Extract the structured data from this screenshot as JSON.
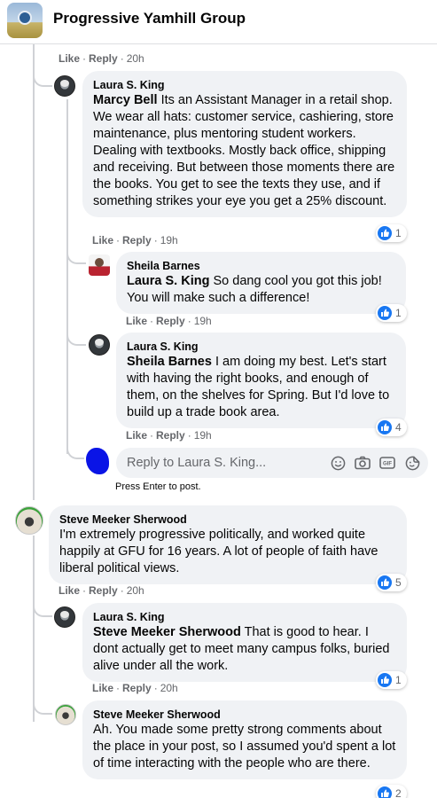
{
  "header": {
    "group_name": "Progressive Yamhill Group"
  },
  "action_labels": {
    "like": "Like",
    "reply": "Reply"
  },
  "top_comment": {
    "time": "20h"
  },
  "comments": [
    {
      "author": "Laura S. King",
      "tag": "Marcy Bell",
      "text": "Its an Assistant Manager in a retail shop. We wear all hats: customer service, cashiering, store maintenance, plus mentoring student workers. Dealing with textbooks. Mostly back office, shipping and receiving. But between those moments there are the books. You get to see the texts they use, and if something strikes your eye you get a 25% discount.",
      "time": "19h",
      "likes": "1"
    },
    {
      "author": "Sheila Barnes",
      "tag": "Laura S. King",
      "text": "So dang cool you got this job! You will make such a difference!",
      "time": "19h",
      "likes": "1"
    },
    {
      "author": "Laura S. King",
      "tag": "Sheila Barnes",
      "text": "I am doing my best. Let's start with having the right books, and enough of them, on the shelves for Spring. But I'd love to build up a trade book area.",
      "time": "19h",
      "likes": "4"
    },
    {
      "author": "Steve Meeker Sherwood",
      "tag": "",
      "text": "I'm extremely progressive politically, and worked quite happily at GFU for 16 years. A lot of people of faith have liberal political views.",
      "time": "20h",
      "likes": "5"
    },
    {
      "author": "Laura S. King",
      "tag": "Steve Meeker Sherwood",
      "text": "That is good to hear. I dont actually get to meet many campus folks, buried alive under all the work.",
      "time": "20h",
      "likes": "1"
    },
    {
      "author": "Steve Meeker Sherwood",
      "tag": "",
      "text": "Ah. You made some pretty strong comments about the place in your post, so I assumed you'd spent a lot of time interacting with the people who are there.",
      "time": "",
      "likes": "2"
    }
  ],
  "reply_box": {
    "placeholder": "Reply to Laura S. King...",
    "hint": "Press Enter to post.",
    "icons": [
      "emoji-icon",
      "camera-icon",
      "gif-icon",
      "sticker-icon"
    ]
  },
  "colors": {
    "like_blue": "#1877f2",
    "bubble_gray": "#f0f2f5",
    "meta_gray": "#65676b",
    "self_avatar_blue": "#0a14e6"
  }
}
